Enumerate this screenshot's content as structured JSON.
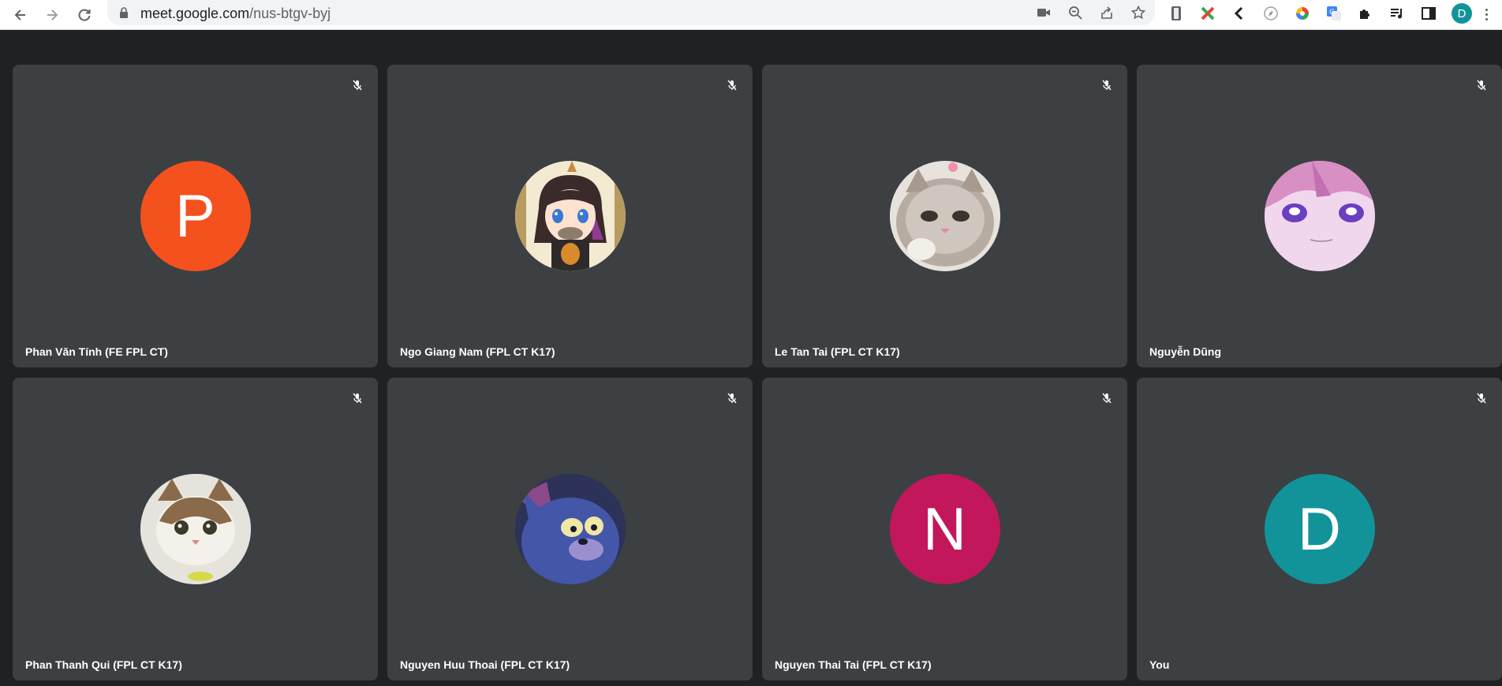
{
  "browser": {
    "url_host": "meet.google.com",
    "url_path": "/nus-btgv-byj",
    "profile_initial": "D",
    "profile_color": "#12939a",
    "icons": [
      "back-icon",
      "forward-icon",
      "reload-icon",
      "lock-icon",
      "camera-icon",
      "zoom-out-icon",
      "share-icon",
      "star-icon"
    ],
    "extensions": [
      "phone-extension-icon",
      "tools-extension-icon",
      "chevron-extension-icon",
      "compass-extension-icon",
      "color-wheel-extension-icon",
      "translate-extension-icon",
      "puzzle-icon",
      "media-control-icon",
      "side-panel-icon"
    ]
  },
  "meet": {
    "background": "#202124",
    "tile_color": "#3c4043",
    "participants": [
      {
        "name": "Phan Văn Tính (FE FPL CT)",
        "avatar_type": "initial",
        "initial": "P",
        "color": "#f4511e",
        "muted": true
      },
      {
        "name": "Ngo Giang Nam (FPL CT K17)",
        "avatar_type": "image",
        "image_desc": "anime-girl-avatar",
        "muted": true
      },
      {
        "name": "Le Tan Tai (FPL CT K17)",
        "avatar_type": "image",
        "image_desc": "gray-cat-avatar",
        "muted": true
      },
      {
        "name": "Nguyễn Dũng",
        "avatar_type": "image",
        "image_desc": "anime-pink-hair-avatar",
        "muted": true
      },
      {
        "name": "Phan Thanh Qui (FPL CT K17)",
        "avatar_type": "image",
        "image_desc": "tabby-cat-avatar",
        "muted": true
      },
      {
        "name": "Nguyen Huu Thoai (FPL CT K17)",
        "avatar_type": "image",
        "image_desc": "cartoon-cat-avatar",
        "muted": true
      },
      {
        "name": "Nguyen Thai Tai (FPL CT K17)",
        "avatar_type": "initial",
        "initial": "N",
        "color": "#c2185b",
        "muted": true
      },
      {
        "name": "You",
        "avatar_type": "initial",
        "initial": "D",
        "color": "#12939a",
        "muted": true
      }
    ]
  }
}
